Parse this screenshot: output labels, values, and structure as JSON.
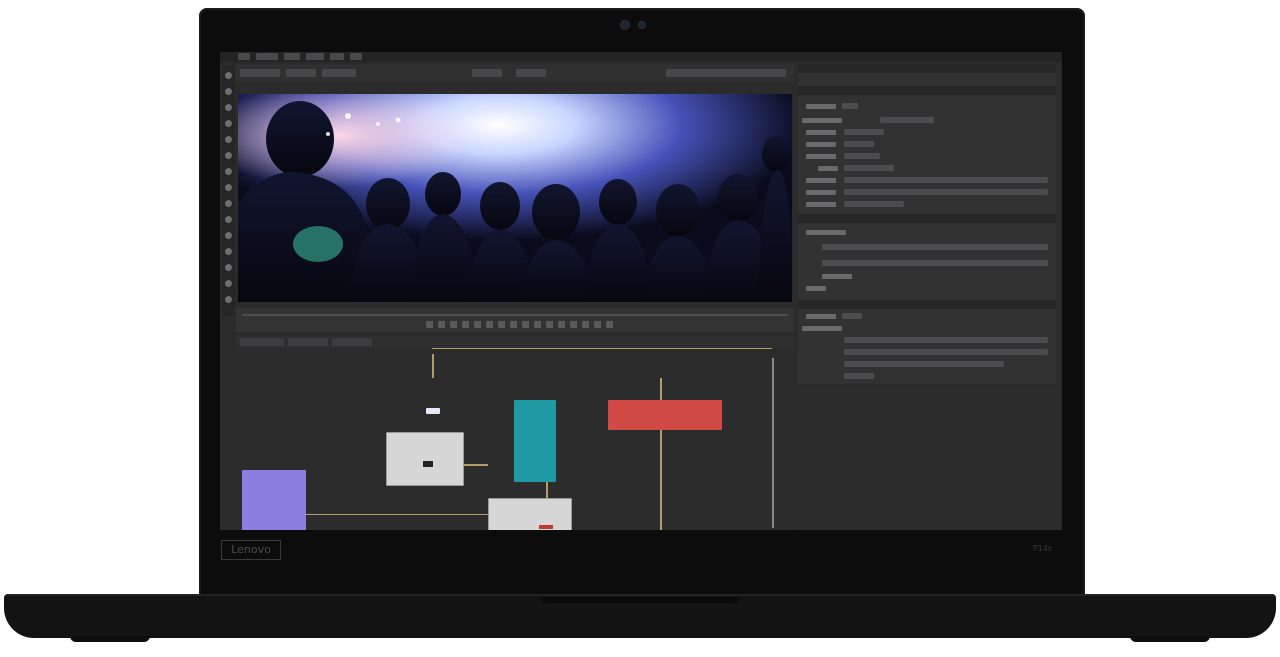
{
  "device": {
    "brand_label": "Lenovo",
    "model_label": "P14s"
  },
  "colors": {
    "node_purple": "#8a7fe0",
    "node_teal": "#1f9aa4",
    "node_red": "#d24a45",
    "node_gray": "#cfcfcf",
    "node_cyan": "#2bb8d0",
    "wire": "#b49b6c"
  },
  "icons": [
    "camera-icon",
    "toolbar-icons",
    "playback-icons"
  ]
}
